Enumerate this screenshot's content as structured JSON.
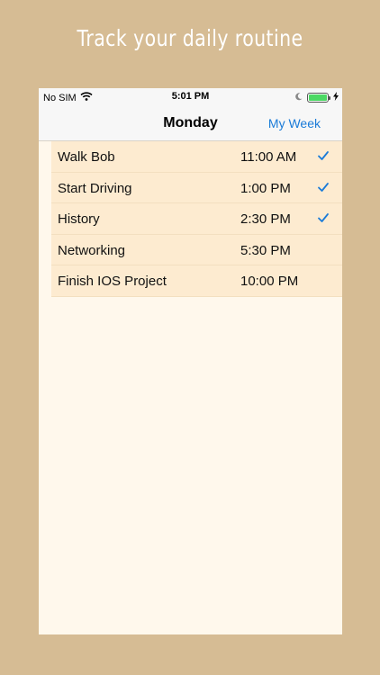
{
  "promo": {
    "title": "Track your daily routine"
  },
  "status_bar": {
    "carrier": "No SIM",
    "time": "5:01 PM"
  },
  "nav": {
    "title": "Monday",
    "action_label": "My Week"
  },
  "colors": {
    "background": "#d6bc94",
    "row_background": "#fdebd0",
    "accent": "#1a7bd8",
    "battery": "#4cd964"
  },
  "tasks": [
    {
      "name": "Walk Bob",
      "time": "11:00 AM",
      "done": true
    },
    {
      "name": "Start Driving",
      "time": "1:00 PM",
      "done": true
    },
    {
      "name": "History",
      "time": "2:30 PM",
      "done": true
    },
    {
      "name": "Networking",
      "time": "5:30 PM",
      "done": false
    },
    {
      "name": "Finish IOS Project",
      "time": "10:00 PM",
      "done": false
    }
  ]
}
